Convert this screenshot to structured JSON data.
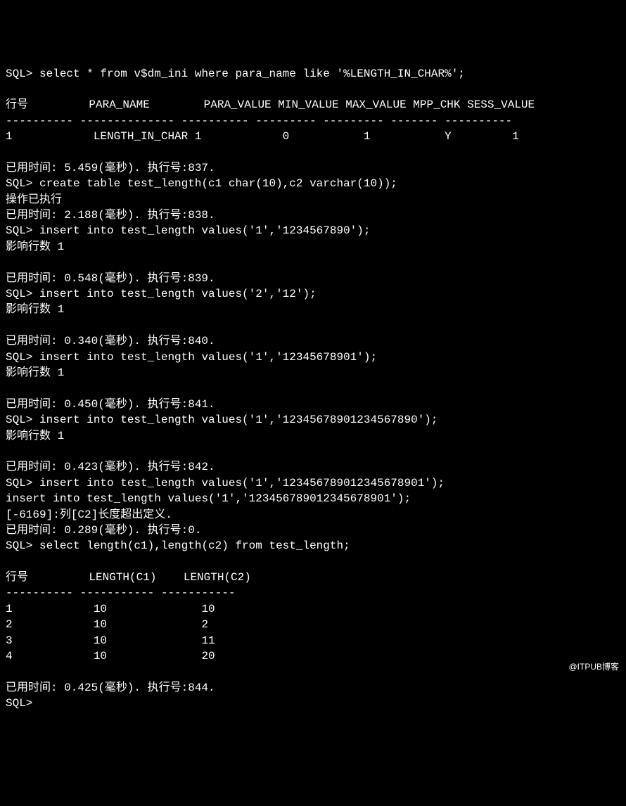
{
  "lines": [
    "SQL> select * from v$dm_ini where para_name like '%LENGTH_IN_CHAR%';",
    "",
    "行号         PARA_NAME        PARA_VALUE MIN_VALUE MAX_VALUE MPP_CHK SESS_VALUE",
    "---------- -------------- ---------- --------- --------- ------- ----------",
    "1            LENGTH_IN_CHAR 1            0           1           Y         1",
    "",
    "已用时间: 5.459(毫秒). 执行号:837.",
    "SQL> create table test_length(c1 char(10),c2 varchar(10));",
    "操作已执行",
    "已用时间: 2.188(毫秒). 执行号:838.",
    "SQL> insert into test_length values('1','1234567890');",
    "影响行数 1",
    "",
    "已用时间: 0.548(毫秒). 执行号:839.",
    "SQL> insert into test_length values('2','12');",
    "影响行数 1",
    "",
    "已用时间: 0.340(毫秒). 执行号:840.",
    "SQL> insert into test_length values('1','12345678901');",
    "影响行数 1",
    "",
    "已用时间: 0.450(毫秒). 执行号:841.",
    "SQL> insert into test_length values('1','12345678901234567890');",
    "影响行数 1",
    "",
    "已用时间: 0.423(毫秒). 执行号:842.",
    "SQL> insert into test_length values('1','123456789012345678901');",
    "insert into test_length values('1','123456789012345678901');",
    "[-6169]:列[C2]长度超出定义.",
    "已用时间: 0.289(毫秒). 执行号:0.",
    "SQL> select length(c1),length(c2) from test_length;",
    "",
    "行号         LENGTH(C1)    LENGTH(C2)",
    "---------- ----------- -----------",
    "1            10              10",
    "2            10              2",
    "3            10              11",
    "4            10              20",
    "",
    "已用时间: 0.425(毫秒). 执行号:844.",
    "SQL>"
  ],
  "watermark": "@ITPUB博客",
  "query_result_table1": {
    "headers": [
      "行号",
      "PARA_NAME",
      "PARA_VALUE",
      "MIN_VALUE",
      "MAX_VALUE",
      "MPP_CHK",
      "SESS_VALUE"
    ],
    "rows": [
      [
        "1",
        "LENGTH_IN_CHAR",
        "1",
        "0",
        "1",
        "Y",
        "1"
      ]
    ]
  },
  "query_result_table2": {
    "headers": [
      "行号",
      "LENGTH(C1)",
      "LENGTH(C2)"
    ],
    "rows": [
      [
        "1",
        "10",
        "10"
      ],
      [
        "2",
        "10",
        "2"
      ],
      [
        "3",
        "10",
        "11"
      ],
      [
        "4",
        "10",
        "20"
      ]
    ]
  },
  "execution_info": [
    {
      "time_ms": "5.459",
      "exec_id": "837"
    },
    {
      "time_ms": "2.188",
      "exec_id": "838"
    },
    {
      "time_ms": "0.548",
      "exec_id": "839"
    },
    {
      "time_ms": "0.340",
      "exec_id": "840"
    },
    {
      "time_ms": "0.450",
      "exec_id": "841"
    },
    {
      "time_ms": "0.423",
      "exec_id": "842"
    },
    {
      "time_ms": "0.289",
      "exec_id": "0"
    },
    {
      "time_ms": "0.425",
      "exec_id": "844"
    }
  ],
  "sql_commands": [
    "select * from v$dm_ini where para_name like '%LENGTH_IN_CHAR%';",
    "create table test_length(c1 char(10),c2 varchar(10));",
    "insert into test_length values('1','1234567890');",
    "insert into test_length values('2','12');",
    "insert into test_length values('1','12345678901');",
    "insert into test_length values('1','12345678901234567890');",
    "insert into test_length values('1','123456789012345678901');",
    "select length(c1),length(c2) from test_length;"
  ],
  "error_message": "[-6169]:列[C2]长度超出定义.",
  "prompt": "SQL>"
}
